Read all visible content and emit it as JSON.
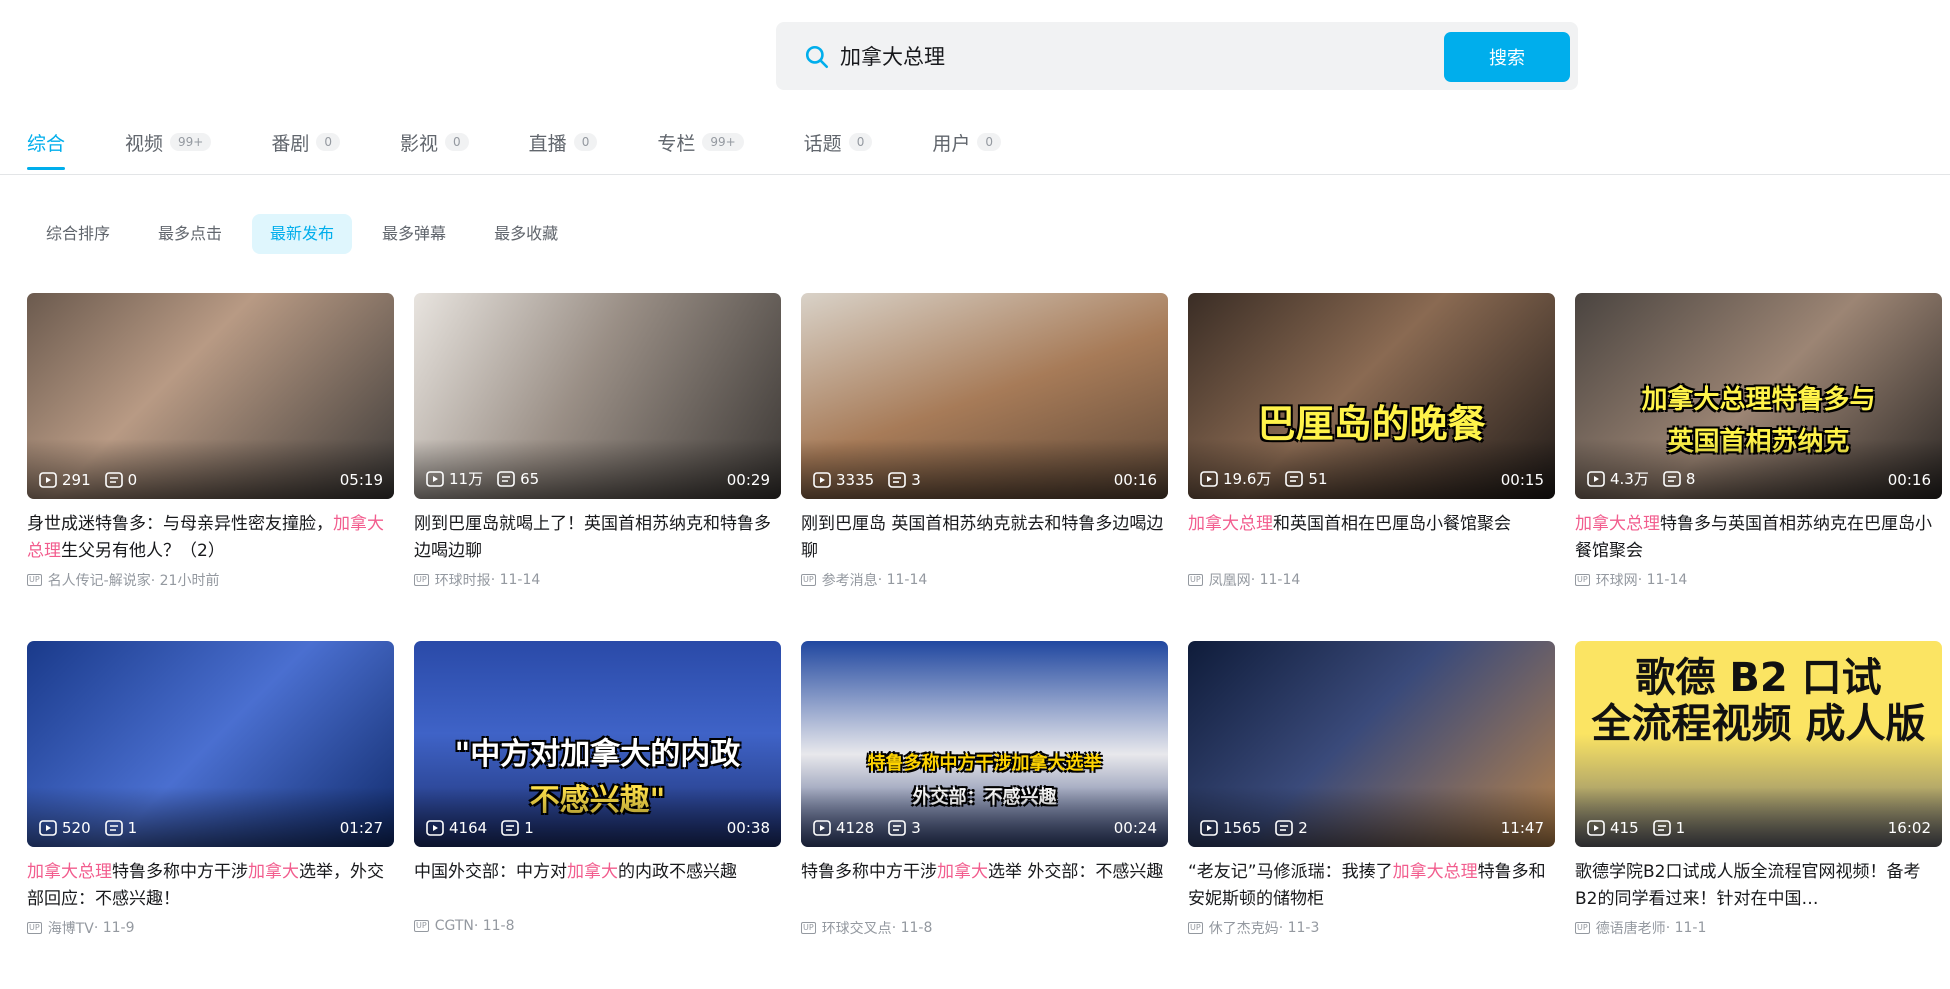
{
  "search": {
    "query": "加拿大总理",
    "button_label": "搜索"
  },
  "tabs": [
    {
      "label": "综合",
      "count": ""
    },
    {
      "label": "视频",
      "count": "99+"
    },
    {
      "label": "番剧",
      "count": "0"
    },
    {
      "label": "影视",
      "count": "0"
    },
    {
      "label": "直播",
      "count": "0"
    },
    {
      "label": "专栏",
      "count": "99+"
    },
    {
      "label": "话题",
      "count": "0"
    },
    {
      "label": "用户",
      "count": "0"
    }
  ],
  "sorts": [
    "综合排序",
    "最多点击",
    "最新发布",
    "最多弹幕",
    "最多收藏"
  ],
  "active_sort": "最新发布",
  "videos": [
    {
      "views": "291",
      "danmaku": "0",
      "duration": "05:19",
      "title": [
        {
          "t": "身世成迷特鲁多：与母亲异性密友撞脸，"
        },
        {
          "t": "加拿大总理",
          "hl": true
        },
        {
          "t": "生父另有他人？（2）"
        }
      ],
      "uploader": "名人传记-解说家",
      "date": "21小时前",
      "overlay": "",
      "overlay_line2": ""
    },
    {
      "views": "11万",
      "danmaku": "65",
      "duration": "00:29",
      "title": [
        {
          "t": "刚到巴厘岛就喝上了！英国首相苏纳克和特鲁多边喝边聊"
        }
      ],
      "uploader": "环球时报",
      "date": "11-14",
      "overlay": "",
      "overlay_line2": ""
    },
    {
      "views": "3335",
      "danmaku": "3",
      "duration": "00:16",
      "title": [
        {
          "t": "刚到巴厘岛 英国首相苏纳克就去和特鲁多边喝边聊"
        }
      ],
      "uploader": "参考消息",
      "date": "11-14",
      "overlay": "",
      "overlay_line2": ""
    },
    {
      "views": "19.6万",
      "danmaku": "51",
      "duration": "00:15",
      "title": [
        {
          "t": "加拿大总理",
          "hl": true
        },
        {
          "t": "和英国首相在巴厘岛小餐馆聚会"
        }
      ],
      "uploader": "凤凰网",
      "date": "11-14",
      "overlay": "巴厘岛的晚餐",
      "overlay_line2": ""
    },
    {
      "views": "4.3万",
      "danmaku": "8",
      "duration": "00:16",
      "title": [
        {
          "t": "加拿大总理",
          "hl": true
        },
        {
          "t": "特鲁多与英国首相苏纳克在巴厘岛小餐馆聚会"
        }
      ],
      "uploader": "环球网",
      "date": "11-14",
      "overlay": "加拿大总理特鲁多与",
      "overlay_line2": "英国首相苏纳克"
    },
    {
      "views": "520",
      "danmaku": "1",
      "duration": "01:27",
      "title": [
        {
          "t": "加拿大总理",
          "hl": true
        },
        {
          "t": "特鲁多称中方干涉"
        },
        {
          "t": "加拿大",
          "hl": true
        },
        {
          "t": "选举，外交部回应：不感兴趣！"
        }
      ],
      "uploader": "海博TV",
      "date": "11-9",
      "overlay": "",
      "overlay_line2": ""
    },
    {
      "views": "4164",
      "danmaku": "1",
      "duration": "00:38",
      "title": [
        {
          "t": "中国外交部：中方对"
        },
        {
          "t": "加拿大",
          "hl": true
        },
        {
          "t": "的内政不感兴趣"
        }
      ],
      "uploader": "CGTN",
      "date": "11-8",
      "overlay": "\"中方对加拿大的内政",
      "overlay_line2": "不感兴趣\""
    },
    {
      "views": "4128",
      "danmaku": "3",
      "duration": "00:24",
      "title": [
        {
          "t": "特鲁多称中方干涉"
        },
        {
          "t": "加拿大",
          "hl": true
        },
        {
          "t": "选举 外交部：不感兴趣"
        }
      ],
      "uploader": "环球交叉点",
      "date": "11-8",
      "overlay": "特鲁多称中方干涉加拿大选举",
      "overlay_line2": "外交部：不感兴趣"
    },
    {
      "views": "1565",
      "danmaku": "2",
      "duration": "11:47",
      "title": [
        {
          "t": "“老友记”马修派瑞：我揍了"
        },
        {
          "t": "加拿大总理",
          "hl": true
        },
        {
          "t": "特鲁多和安妮斯顿的储物柜"
        }
      ],
      "uploader": "休了杰克妈",
      "date": "11-3",
      "overlay": "",
      "overlay_line2": ""
    },
    {
      "views": "415",
      "danmaku": "1",
      "duration": "16:02",
      "title": [
        {
          "t": "歌德学院B2口试成人版全流程官网视频！备考B2的同学看过来！针对在中国…"
        }
      ],
      "uploader": "德语唐老师",
      "date": "11-1",
      "overlay": "歌德 B2 口试",
      "overlay_line2": "全流程视频 成人版"
    }
  ],
  "colors": {
    "accent": "#00aeec",
    "highlight": "#f25d8e"
  }
}
